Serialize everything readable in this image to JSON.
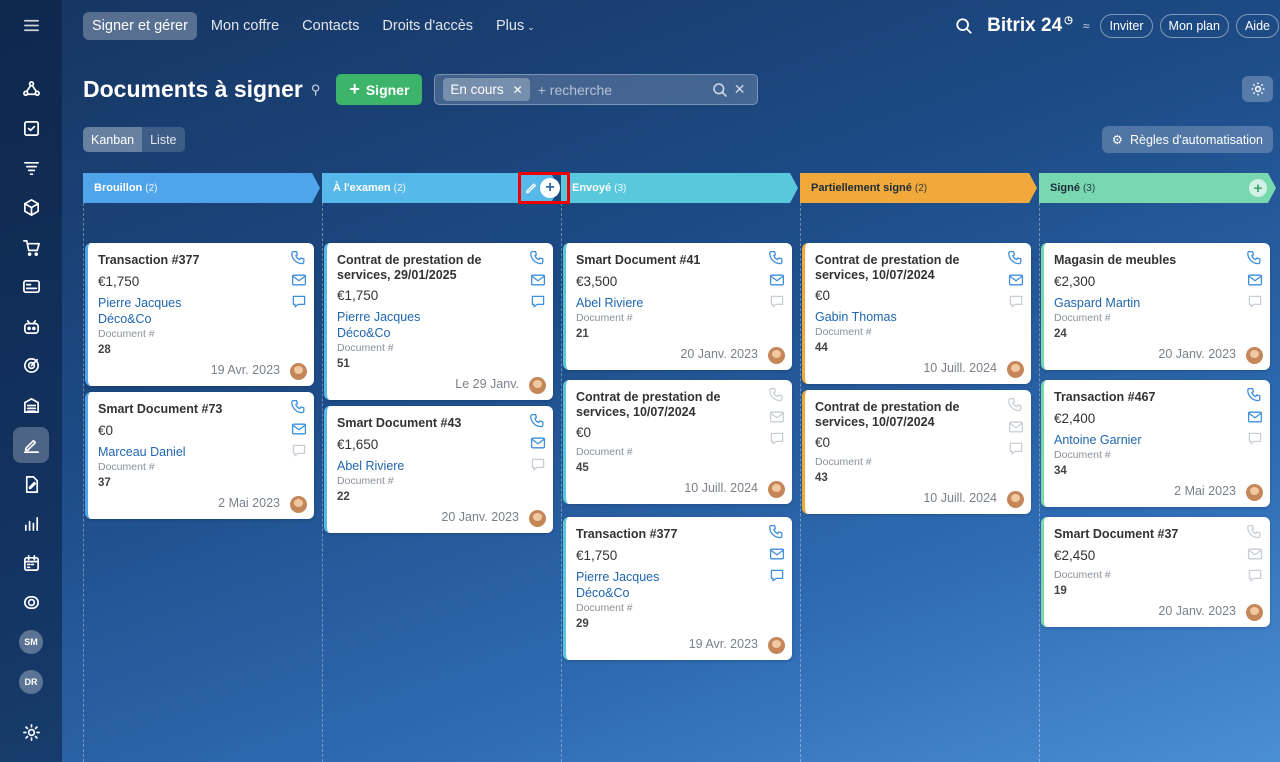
{
  "topnav": {
    "items": [
      "Signer et gérer",
      "Mon coffre",
      "Contacts",
      "Droits d'accès",
      "Plus"
    ],
    "brand": "Bitrix 24",
    "invite": "Inviter",
    "plan": "Mon plan",
    "help": "Aide"
  },
  "sidebar": {
    "icons": [
      "hamburger-icon",
      "network-icon",
      "checkbox-icon",
      "filter-icon",
      "box-icon",
      "cart-icon",
      "card-icon",
      "robot-icon",
      "target-icon",
      "building-icon",
      "sign-icon",
      "document-edit-icon",
      "chart-icon",
      "calendar-icon",
      "support-icon"
    ],
    "avatars": [
      "SM",
      "DR"
    ]
  },
  "page": {
    "title": "Documents à signer",
    "sign_button": "Signer",
    "filter_chip": "En cours",
    "search_placeholder": "+ recherche",
    "views": [
      "Kanban",
      "Liste"
    ],
    "automation": "Règles d'automatisation"
  },
  "columns": [
    {
      "name": "Brouillon",
      "count": "(2)",
      "color": "#4fa4ea",
      "cards": [
        {
          "title": "Transaction #377",
          "amount": "€1,750",
          "links": [
            "Pierre Jacques",
            "Déco&Co"
          ],
          "doc_label": "Document #",
          "doc": "28",
          "date": "19 Avr. 2023",
          "icons": [
            true,
            true,
            true
          ]
        },
        {
          "title": "Smart Document #73",
          "amount": "€0",
          "links": [
            "Marceau Daniel"
          ],
          "doc_label": "Document #",
          "doc": "37",
          "date": "2 Mai 2023",
          "icons": [
            true,
            true,
            false
          ]
        }
      ]
    },
    {
      "name": "À l'examen",
      "count": "(2)",
      "color": "#57b9ea",
      "cards": [
        {
          "title": "Contrat de prestation de services, 29/01/2025",
          "amount": "€1,750",
          "links": [
            "Pierre Jacques",
            "Déco&Co"
          ],
          "doc_label": "Document #",
          "doc": "51",
          "date": "Le 29 Janv.",
          "icons": [
            true,
            true,
            true
          ]
        },
        {
          "title": "Smart Document #43",
          "amount": "€1,650",
          "links": [
            "Abel Riviere"
          ],
          "doc_label": "Document #",
          "doc": "22",
          "date": "20 Janv. 2023",
          "icons": [
            true,
            true,
            false
          ]
        }
      ]
    },
    {
      "name": "Envoyé",
      "count": "(3)",
      "color": "#5ac8dc",
      "cards": [
        {
          "title": "Smart Document #41",
          "amount": "€3,500",
          "links": [
            "Abel Riviere"
          ],
          "doc_label": "Document #",
          "doc": "21",
          "date": "20 Janv. 2023",
          "icons": [
            true,
            true,
            false
          ]
        },
        {
          "title": "Contrat de prestation de services, 10/07/2024",
          "amount": "€0",
          "links": [],
          "doc_label": "Document #",
          "doc": "45",
          "date": "10 Juill. 2024",
          "icons": [
            false,
            false,
            false
          ]
        },
        {
          "title": "Transaction #377",
          "amount": "€1,750",
          "links": [
            "Pierre Jacques",
            "Déco&Co"
          ],
          "doc_label": "Document #",
          "doc": "29",
          "date": "19 Avr. 2023",
          "icons": [
            true,
            true,
            true
          ]
        }
      ]
    },
    {
      "name": "Partiellement signé",
      "count": "(2)",
      "color": "#f2a93b",
      "cards": [
        {
          "title": "Contrat de prestation de services, 10/07/2024",
          "amount": "€0",
          "links": [
            "Gabin Thomas"
          ],
          "doc_label": "Document #",
          "doc": "44",
          "date": "10 Juill. 2024",
          "icons": [
            true,
            true,
            false
          ]
        },
        {
          "title": "Contrat de prestation de services, 10/07/2024",
          "amount": "€0",
          "links": [],
          "doc_label": "Document #",
          "doc": "43",
          "date": "10 Juill. 2024",
          "icons": [
            false,
            false,
            false
          ]
        }
      ]
    },
    {
      "name": "Signé",
      "count": "(3)",
      "color": "#7ad8b0",
      "cards": [
        {
          "title": "Magasin de meubles",
          "amount": "€2,300",
          "links": [
            "Gaspard Martin"
          ],
          "doc_label": "Document #",
          "doc": "24",
          "date": "20 Janv. 2023",
          "icons": [
            true,
            true,
            false
          ]
        },
        {
          "title": "Transaction #467",
          "amount": "€2,400",
          "links": [
            "Antoine Garnier"
          ],
          "doc_label": "Document #",
          "doc": "34",
          "date": "2 Mai 2023",
          "icons": [
            true,
            true,
            false
          ]
        },
        {
          "title": "Smart Document #37",
          "amount": "€2,450",
          "links": [],
          "doc_label": "Document #",
          "doc": "19",
          "date": "20 Janv. 2023",
          "icons": [
            false,
            false,
            false
          ]
        }
      ]
    }
  ]
}
